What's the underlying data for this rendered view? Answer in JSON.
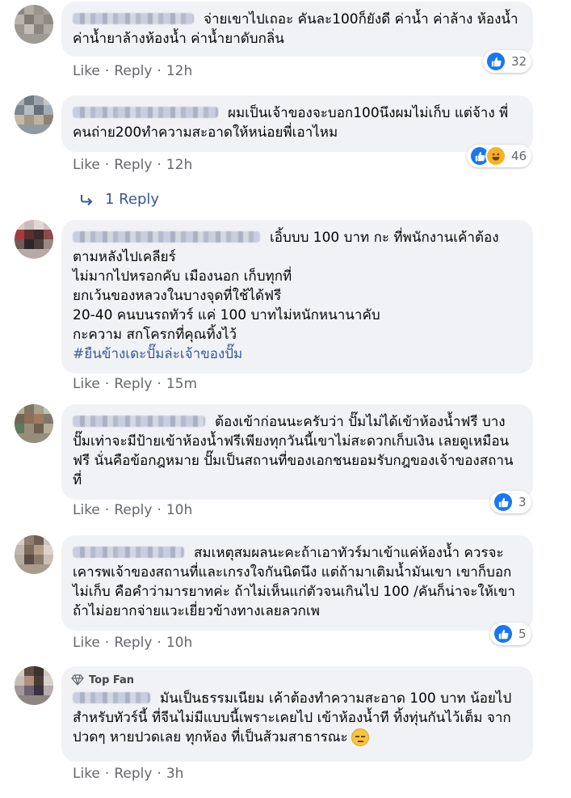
{
  "actions": {
    "like": "Like",
    "reply": "Reply"
  },
  "comments": [
    {
      "text": "จ่ายเขาไปเถอะ คันละ100ก็ยังดี ค่าน้ำ ค่าล้าง ห้องน้ำ ค่าน้ำยาล้างห้องน้ำ ค่าน้ำยาดับกลิ่น",
      "time": "12h",
      "reaction_count": "32",
      "reactions": [
        "like-icon"
      ]
    },
    {
      "text": "ผมเป็นเจ้าของจะบอก100นึงผมไม่เก็บ แต่จ้าง พี่คนถ่าย200ทำความสะอาดให้หน่อยพี่เอาไหม",
      "time": "12h",
      "reaction_count": "46",
      "reactions": [
        "like-icon",
        "haha-icon"
      ],
      "replies_label": "1 Reply"
    },
    {
      "text": "เอิ้บบบ 100 บาท กะ ที่พนักงานเค้าต้อง ตามหลังไปเคลียร์\nไม่มากไปหรอกคับ เมืองนอก เก็บทุกที่\nยกเว้นของหลวงในบางจุดที่ใช้ได้ฟรี\n20-40 คนบนรถทัวร์ แค่ 100 บาทไม่หนักหนานาคับ\nกะความ สกโครกที่คุณทิ้งไว้",
      "hashtag": "#ยืนข้างเดะปั๊มล่ะเจ้าของปั๊ม",
      "time": "15m"
    },
    {
      "text": "ต้องเข้าก่อนนะครับว่า ปั๊มไม่ได้เข้าห้องน้ำฟรี บางปั๊มเท่าจะมีป้ายเข้าห้องน้ำฟรีเพียงทุกวันนี้เขาไม่สะดวกเก็บเงิน เลยดูเหมือนฟรี นั่นคือข้อกฎหมาย ปั๊มเป็นสถานที่ของเอกชนยอมรับกฎของเจ้าของสถานที่",
      "time": "10h",
      "reaction_count": "3",
      "reactions": [
        "like-icon"
      ]
    },
    {
      "text": "สมเหตุสมผลนะคะถ้าเอาทัวร์มาเข้าแค่ห้องน้ำ ควรจะเคารพเจ้าของสถานที่และเกรงใจกันนิดนึง แต่ถ้ามาเติมน้ำมันเขา เขาก็บอกไม่เก็บ คือคำว่ามารยาทค่ะ ถ้าไม่เห็นแก่ตัวจนเกินไป 100 /คันก็น่าจะให้เขาถ้าไม่อยากจ่ายแวะเยี่ยวข้างทางเลยลวกเพ",
      "time": "10h",
      "reaction_count": "5",
      "reactions": [
        "like-icon"
      ]
    },
    {
      "badge": "Top Fan",
      "text": "มันเป็นธรรมเนียม เค้าต้องทำความสะอาด 100 บาท น้อยไปสำหรับทัวร์นี้ ที่จีนไม่มีแบบนี้เพราะเคยไป เข้าห้องน้ำที ทิ้งทุ่นกันไว้เต็ม จากปวดๆ หายปวดเลย ทุกห้อง ที่เป็นส้วมสาธารณะ",
      "emoji": "expressionless-face-icon",
      "time": "3h"
    }
  ]
}
